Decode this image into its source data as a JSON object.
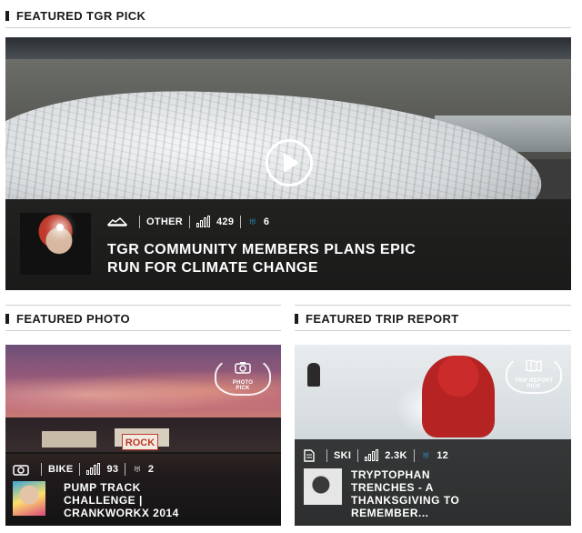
{
  "featured_pick": {
    "heading": "FEATURED TGR PICK",
    "category": "OTHER",
    "views": "429",
    "likes": "6",
    "title_line1": "TGR COMMUNITY MEMBERS PLANS EPIC",
    "title_line2": "RUN FOR CLIMATE CHANGE"
  },
  "featured_photo": {
    "heading": "FEATURED PHOTO",
    "badge_line1": "PHOTO",
    "badge_line2": "PICK",
    "sign_text": "ROCK",
    "category": "BIKE",
    "views": "93",
    "likes": "2",
    "title_line1": "PUMP TRACK",
    "title_line2": "CHALLENGE |",
    "title_line3": "CRANKWORKX 2014"
  },
  "featured_trip": {
    "heading": "FEATURED TRIP REPORT",
    "badge_line1": "TRIP REPORT",
    "badge_line2": "PICK",
    "category": "SKI",
    "views": "2.3K",
    "likes": "12",
    "title_line1": "TRYPTOPHAN",
    "title_line2": "TRENCHES - A",
    "title_line3": "THANKSGIVING TO",
    "title_line4": "REMEMBER..."
  },
  "icons": {
    "play": "play-icon",
    "category_other": "other-category-icon",
    "camera": "camera-icon",
    "document": "document-icon",
    "views": "bar-chart-icon",
    "likes": "claw-icon"
  },
  "colors": {
    "accent_blue": "#2a9fd6",
    "overlay": "#121212"
  }
}
